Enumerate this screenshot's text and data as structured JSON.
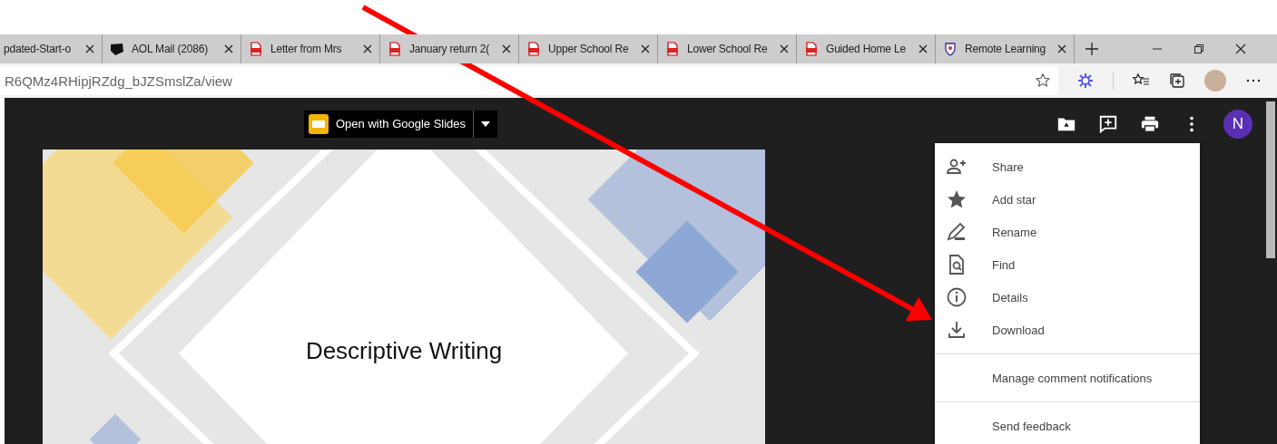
{
  "tabs": [
    {
      "kind": "none",
      "title": "pdated-Start-o"
    },
    {
      "kind": "aol",
      "title": "AOL Mail (2086)"
    },
    {
      "kind": "pdf",
      "title": "Letter from Mrs"
    },
    {
      "kind": "pdf",
      "title": "January return 2("
    },
    {
      "kind": "pdf",
      "title": "Upper School Re"
    },
    {
      "kind": "pdf",
      "title": "Lower School Re"
    },
    {
      "kind": "pdf",
      "title": "Guided Home Le"
    },
    {
      "kind": "shield",
      "title": "Remote Learning"
    }
  ],
  "address_bar": {
    "url": "R6QMz4RHipjRZdg_bJZSmslZa/view"
  },
  "viewer": {
    "open_with": "Open with Google Slides",
    "avatar": "N"
  },
  "slide": {
    "title": "Descriptive Writing"
  },
  "menu": {
    "sections": [
      [
        {
          "kind": "share",
          "label": "Share"
        },
        {
          "kind": "star",
          "label": "Add star"
        },
        {
          "kind": "rename",
          "label": "Rename"
        },
        {
          "kind": "find",
          "label": "Find"
        },
        {
          "kind": "details",
          "label": "Details"
        },
        {
          "kind": "download",
          "label": "Download"
        }
      ],
      [
        {
          "kind": "plain",
          "label": "Manage comment notifications"
        }
      ],
      [
        {
          "kind": "plain",
          "label": "Send feedback"
        }
      ]
    ]
  }
}
